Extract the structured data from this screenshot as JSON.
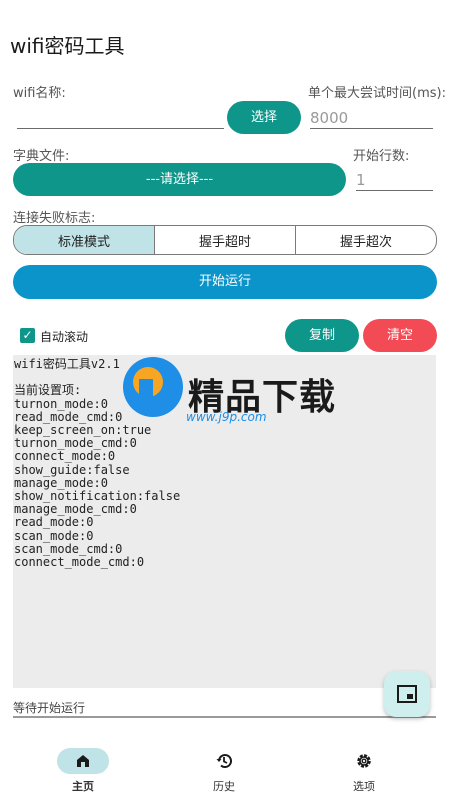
{
  "app": {
    "title": "wifi密码工具"
  },
  "form": {
    "wifi_name_label": "wifi名称:",
    "wifi_name_value": "",
    "select_button": "选择",
    "max_time_label": "单个最大尝试时间(ms):",
    "max_time_value": "8000",
    "dict_label": "字典文件:",
    "dict_button": "---请选择---",
    "start_line_label": "开始行数:",
    "start_line_value": "1",
    "fail_flag_label": "连接失败标志:",
    "modes": [
      "标准模式",
      "握手超时",
      "握手超次"
    ],
    "selected_mode": "标准模式",
    "run_button": "开始运行"
  },
  "log_controls": {
    "auto_scroll_label": "自动滚动",
    "auto_scroll_checked": true,
    "copy_button": "复制",
    "clear_button": "清空"
  },
  "log": {
    "lines": [
      "wifi密码工具v2.1",
      "",
      "当前设置项:",
      "turnon_mode:0",
      "read_mode_cmd:0",
      "keep_screen_on:true",
      "turnon_mode_cmd:0",
      "connect_mode:0",
      "show_guide:false",
      "manage_mode:0",
      "show_notification:false",
      "manage_mode_cmd:0",
      "read_mode:0",
      "scan_mode:0",
      "scan_mode_cmd:0",
      "connect_mode_cmd:0"
    ]
  },
  "status": {
    "text": "等待开始运行"
  },
  "watermark": {
    "brand": "精品下载",
    "url": "www.j9p.com"
  },
  "bottom_nav": [
    {
      "label": "主页",
      "icon": "home-icon",
      "active": true
    },
    {
      "label": "历史",
      "icon": "history-icon",
      "active": false
    },
    {
      "label": "选项",
      "icon": "settings-icon",
      "active": false
    }
  ],
  "colors": {
    "teal": "#0f968a",
    "blue": "#0b94c9",
    "red": "#f24b55",
    "light_teal": "#bfe3e6"
  }
}
